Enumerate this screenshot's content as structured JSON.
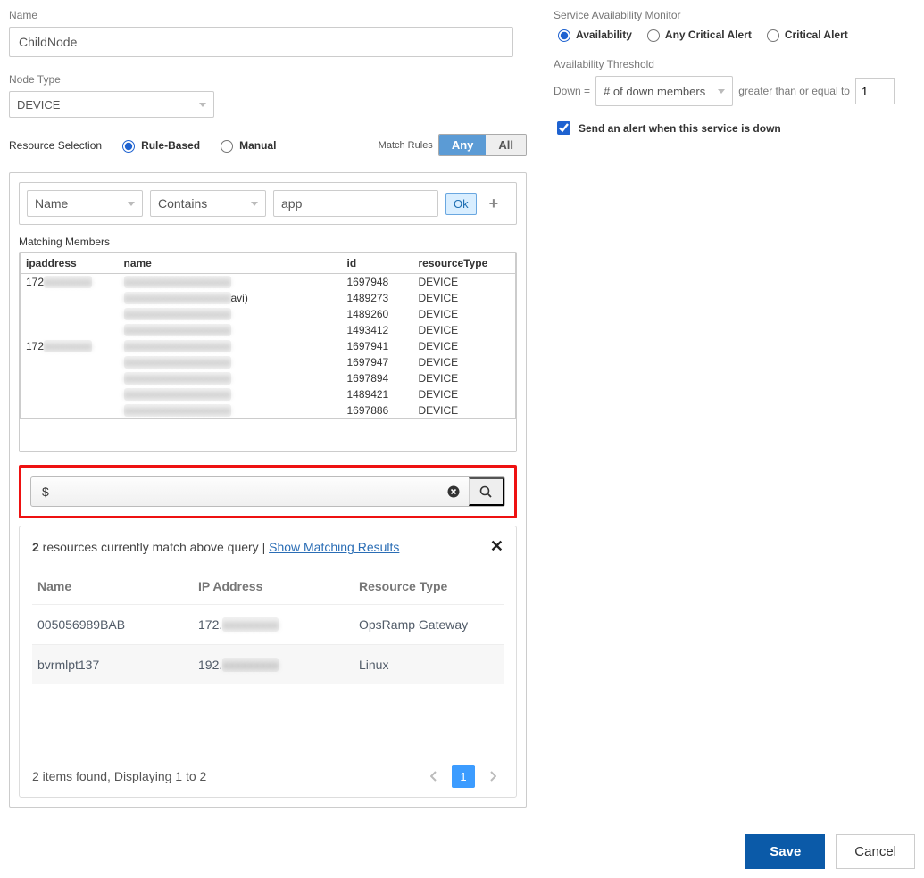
{
  "left": {
    "name_label": "Name",
    "name_value": "ChildNode",
    "node_type_label": "Node Type",
    "node_type_value": "DEVICE",
    "resource_selection_label": "Resource Selection",
    "radio_rule": "Rule-Based",
    "radio_manual": "Manual",
    "match_rules_label": "Match Rules",
    "btn_any": "Any",
    "btn_all": "All",
    "rule_field": "Name",
    "rule_op": "Contains",
    "rule_value": "app",
    "ok": "Ok",
    "matching_members_label": "Matching Members",
    "columns": {
      "ip": "ipaddress",
      "name": "name",
      "id": "id",
      "type": "resourceType"
    },
    "rows": [
      {
        "ip": "172",
        "name_suffix": "",
        "id": "1697948",
        "type": "DEVICE"
      },
      {
        "ip": "",
        "name_suffix": "avi)",
        "id": "1489273",
        "type": "DEVICE"
      },
      {
        "ip": "",
        "name_suffix": "",
        "id": "1489260",
        "type": "DEVICE"
      },
      {
        "ip": "",
        "name_suffix": "",
        "id": "1493412",
        "type": "DEVICE"
      },
      {
        "ip": "172",
        "name_suffix": "",
        "id": "1697941",
        "type": "DEVICE"
      },
      {
        "ip": "",
        "name_suffix": "",
        "id": "1697947",
        "type": "DEVICE"
      },
      {
        "ip": "",
        "name_suffix": "",
        "id": "1697894",
        "type": "DEVICE"
      },
      {
        "ip": "",
        "name_suffix": "",
        "id": "1489421",
        "type": "DEVICE"
      },
      {
        "ip": "",
        "name_suffix": "",
        "id": "1697886",
        "type": "DEVICE"
      }
    ],
    "query_prefix": "$",
    "results_count": "2",
    "results_text": " resources currently match above query | ",
    "show_link": "Show Matching Results",
    "res_cols": {
      "name": "Name",
      "ip": "IP Address",
      "type": "Resource Type"
    },
    "res_rows": [
      {
        "name": "005056989BAB",
        "ip": "172.",
        "type": "OpsRamp Gateway"
      },
      {
        "name": "bvrmlpt137",
        "ip": "192.",
        "type": "Linux"
      }
    ],
    "pager_info": "2 items found, Displaying 1 to 2",
    "page_num": "1"
  },
  "right": {
    "sam_label": "Service Availability Monitor",
    "r_availability": "Availability",
    "r_any_crit": "Any Critical Alert",
    "r_crit": "Critical Alert",
    "threshold_label": "Availability Threshold",
    "down_prefix": "Down =",
    "down_select": "# of down members",
    "down_suffix": "greater than or equal to",
    "down_value": "1",
    "alert_chk": "Send an alert when this service is down"
  },
  "footer": {
    "save": "Save",
    "cancel": "Cancel"
  }
}
